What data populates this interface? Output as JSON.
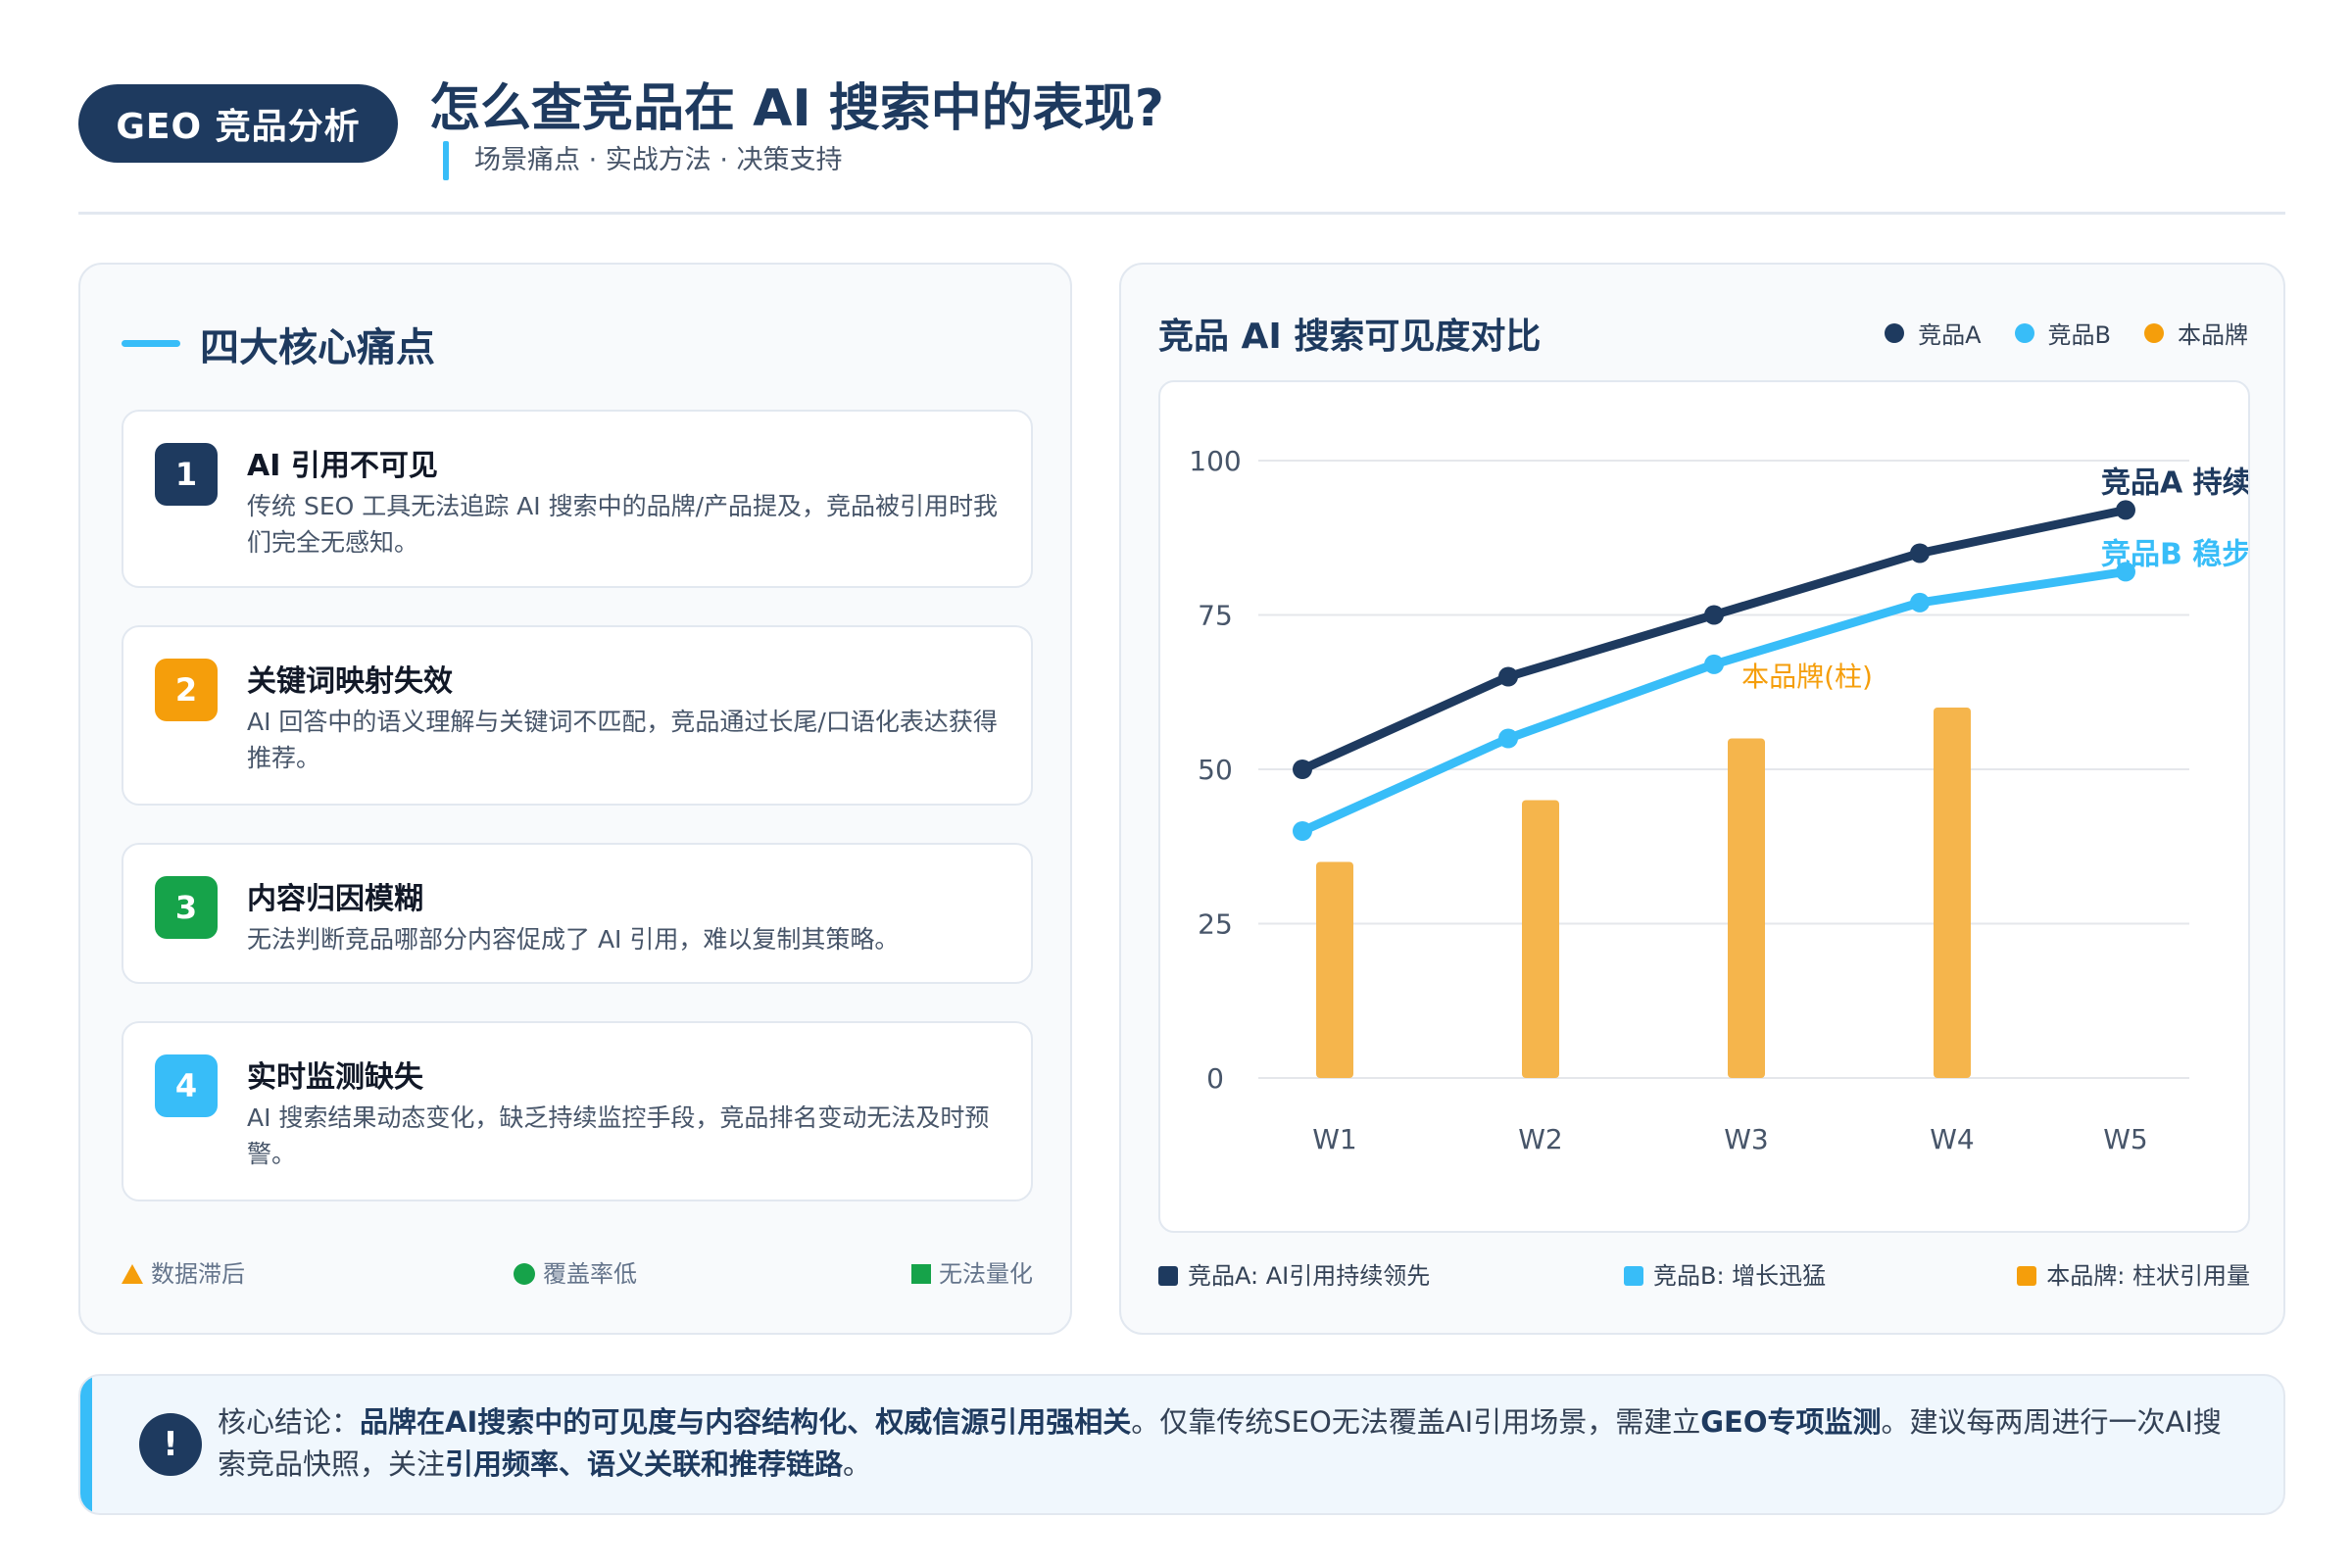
{
  "header": {
    "badge": "GEO 竞品分析",
    "title": "怎么查竞品在 AI 搜索中的表现?",
    "subtitle": "场景痛点 · 实战方法 · 决策支持"
  },
  "pain_points": {
    "title": "四大核心痛点",
    "cards": [
      {
        "num": "1",
        "title": "AI 引用不可见",
        "desc": "传统 SEO 工具无法追踪 AI 搜索中的品牌/产品提及，竞品被引用时我们完全无感知。",
        "color": "#1e3a5f"
      },
      {
        "num": "2",
        "title": "关键词映射失效",
        "desc": "AI 回答中的语义理解与关键词不匹配，竞品通过长尾/口语化表达获得推荐。",
        "color": "#f59e0b"
      },
      {
        "num": "3",
        "title": "内容归因模糊",
        "desc": "无法判断竞品哪部分内容促成了 AI 引用，难以复制其策略。",
        "color": "#16a34a"
      },
      {
        "num": "4",
        "title": "实时监测缺失",
        "desc": "AI 搜索结果动态变化，缺乏持续监控手段，竞品排名变动无法及时预警。",
        "color": "#38bdf8"
      }
    ],
    "legend": [
      {
        "label": "数据滞后",
        "shape": "triangle",
        "color": "#f59e0b"
      },
      {
        "label": "覆盖率低",
        "shape": "circle",
        "color": "#16a34a"
      },
      {
        "label": "无法量化",
        "shape": "square",
        "color": "#16a34a"
      }
    ]
  },
  "chart_panel": {
    "title": "竞品 AI 搜索可见度对比",
    "legend": [
      {
        "label": "竞品A",
        "color": "#1e3a5f"
      },
      {
        "label": "竞品B",
        "color": "#38bdf8"
      },
      {
        "label": "本品牌",
        "color": "#f59e0b"
      }
    ],
    "bottom_legend": [
      {
        "label": "竞品A: AI引用持续领先",
        "color": "#1e3a5f"
      },
      {
        "label": "竞品B: 增长迅猛",
        "color": "#38bdf8"
      },
      {
        "label": "本品牌: 柱状引用量",
        "color": "#f59e0b"
      }
    ]
  },
  "chart_data": {
    "type": "line",
    "x": [
      "W1",
      "W2",
      "W3",
      "W4",
      "W5"
    ],
    "ylim": [
      0,
      100
    ],
    "yticks": [
      0,
      25,
      50,
      75,
      100
    ],
    "grid": true,
    "legend_position": "top-right",
    "series": [
      {
        "name": "竞品A",
        "type": "line",
        "color": "#1e3a5f",
        "values": [
          50,
          65,
          75,
          85,
          92
        ],
        "end_label": "竞品A 持续上"
      },
      {
        "name": "竞品B",
        "type": "line",
        "color": "#38bdf8",
        "values": [
          40,
          55,
          67,
          77,
          82
        ],
        "end_label": "竞品B 稳步增"
      },
      {
        "name": "本品牌",
        "type": "bar",
        "color": "#f5b54c",
        "values": [
          35,
          45,
          55,
          60
        ],
        "label": "本品牌(柱)"
      }
    ]
  },
  "conclusion": {
    "icon": "!",
    "p1": "核心结论：",
    "b1": "品牌在AI搜索中的可见度与内容结构化、权威信源引用强相关",
    "p2": "。仅靠传统SEO无法覆盖AI引用场景，需建立",
    "b2": "GEO专项监测",
    "p3": "。建议每两周进行一次AI搜索竞品快照，关注",
    "b3": "引用频率、语义关联和推荐链路",
    "p4": "。"
  }
}
